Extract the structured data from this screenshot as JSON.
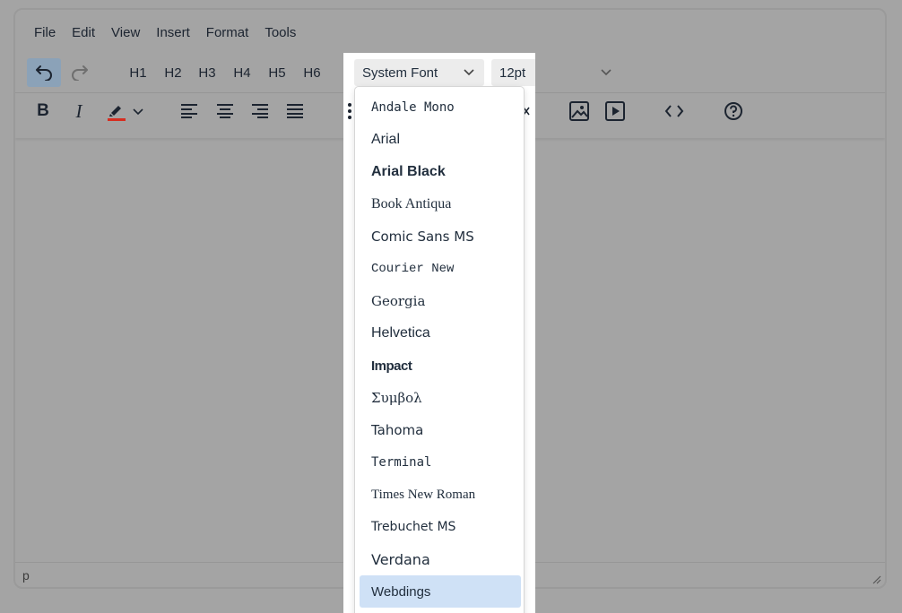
{
  "menubar": {
    "items": [
      "File",
      "Edit",
      "View",
      "Insert",
      "Format",
      "Tools"
    ]
  },
  "toolbar": {
    "headings": [
      "H1",
      "H2",
      "H3",
      "H4",
      "H5",
      "H6"
    ],
    "font_family": "System Font",
    "font_size": "12pt"
  },
  "dropdown": {
    "items": [
      {
        "label": "Andale Mono"
      },
      {
        "label": "Arial"
      },
      {
        "label": "Arial Black"
      },
      {
        "label": "Book Antiqua"
      },
      {
        "label": "Comic Sans MS"
      },
      {
        "label": "Courier New"
      },
      {
        "label": "Georgia"
      },
      {
        "label": "Helvetica"
      },
      {
        "label": "Impact"
      },
      {
        "label": "Συμβολ"
      },
      {
        "label": "Tahoma"
      },
      {
        "label": "Terminal"
      },
      {
        "label": "Times New Roman"
      },
      {
        "label": "Trebuchet MS"
      },
      {
        "label": "Verdana"
      },
      {
        "label": "Webdings"
      }
    ],
    "selected": "Webdings"
  },
  "statusbar": {
    "path": "p"
  },
  "colors": {
    "highlight_red": "#d62d20",
    "selected_bg": "#cfe1f6",
    "active_btn": "#8ba2b8"
  }
}
